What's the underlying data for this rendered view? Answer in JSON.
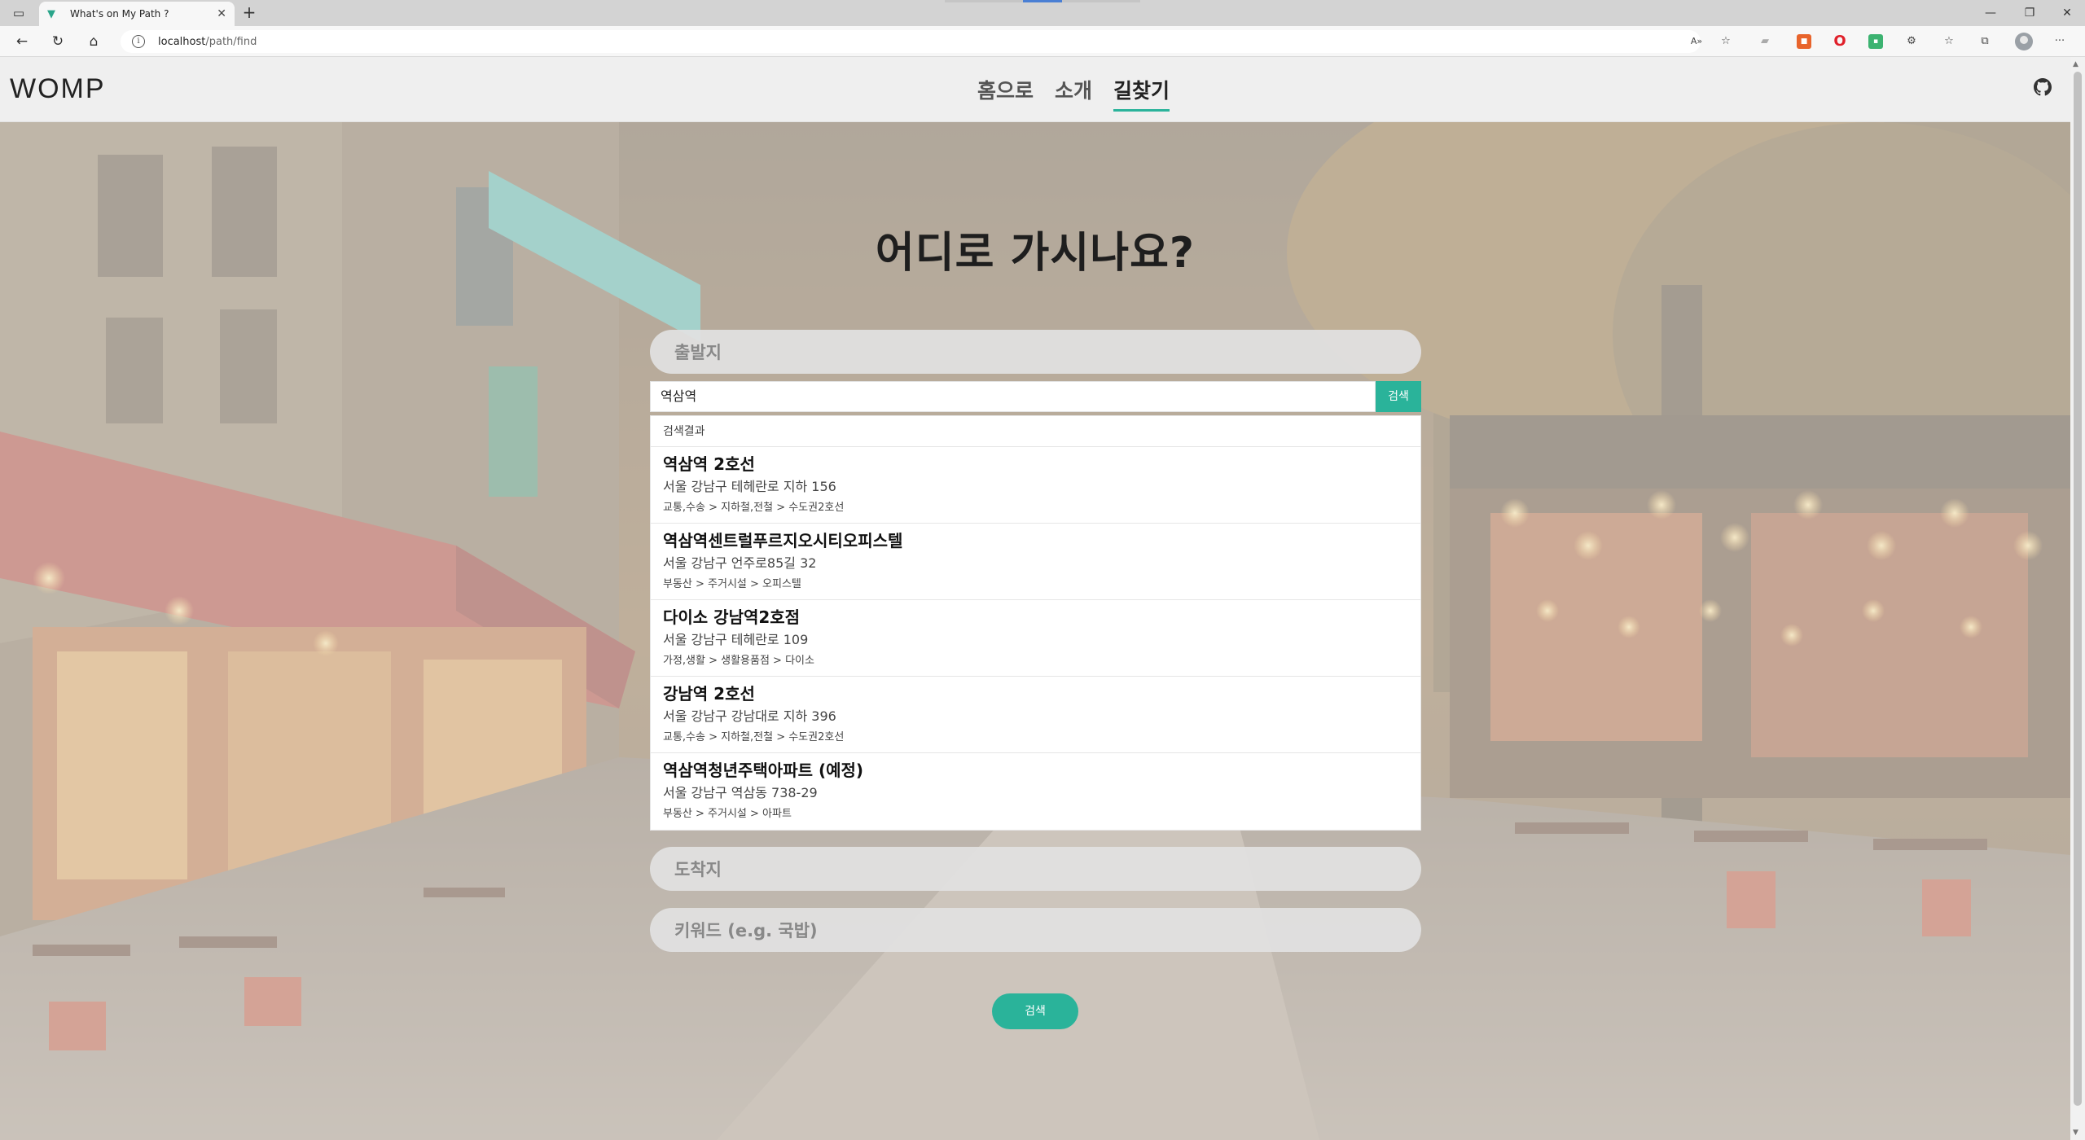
{
  "browser": {
    "tab_title": "What's on My Path ?",
    "tab_close": "✕",
    "new_tab": "+",
    "url_host": "localhost",
    "url_path": "/path/find",
    "minimize": "—",
    "restore": "❐",
    "close": "✕",
    "more": "···"
  },
  "site": {
    "logo": "WOMP",
    "nav": [
      {
        "label": "홈으로"
      },
      {
        "label": "소개"
      },
      {
        "label": "길찾기"
      }
    ]
  },
  "main": {
    "title": "어디로 가시나요?",
    "origin_placeholder": "출발지",
    "search_value": "역삼역",
    "search_button": "검색",
    "results_header": "검색결과",
    "results": [
      {
        "name": "역삼역 2호선",
        "address": "서울 강남구 테헤란로 지하 156",
        "category": "교통,수송 > 지하철,전철 > 수도권2호선"
      },
      {
        "name": "역삼역센트럴푸르지오시티오피스텔",
        "address": "서울 강남구 언주로85길 32",
        "category": "부동산 > 주거시설 > 오피스텔"
      },
      {
        "name": "다이소 강남역2호점",
        "address": "서울 강남구 테헤란로 109",
        "category": "가정,생활 > 생활용품점 > 다이소"
      },
      {
        "name": "강남역 2호선",
        "address": "서울 강남구 강남대로 지하 396",
        "category": "교통,수송 > 지하철,전철 > 수도권2호선"
      },
      {
        "name": "역삼역청년주택아파트 (예정)",
        "address": "서울 강남구 역삼동 738-29",
        "category": "부동산 > 주거시설 > 아파트"
      }
    ],
    "destination_placeholder": "도착지",
    "keyword_placeholder": "키워드 (e.g. 국밥)",
    "submit_button": "검색"
  },
  "colors": {
    "accent": "#2ab39a",
    "header_bg": "#efefef"
  }
}
